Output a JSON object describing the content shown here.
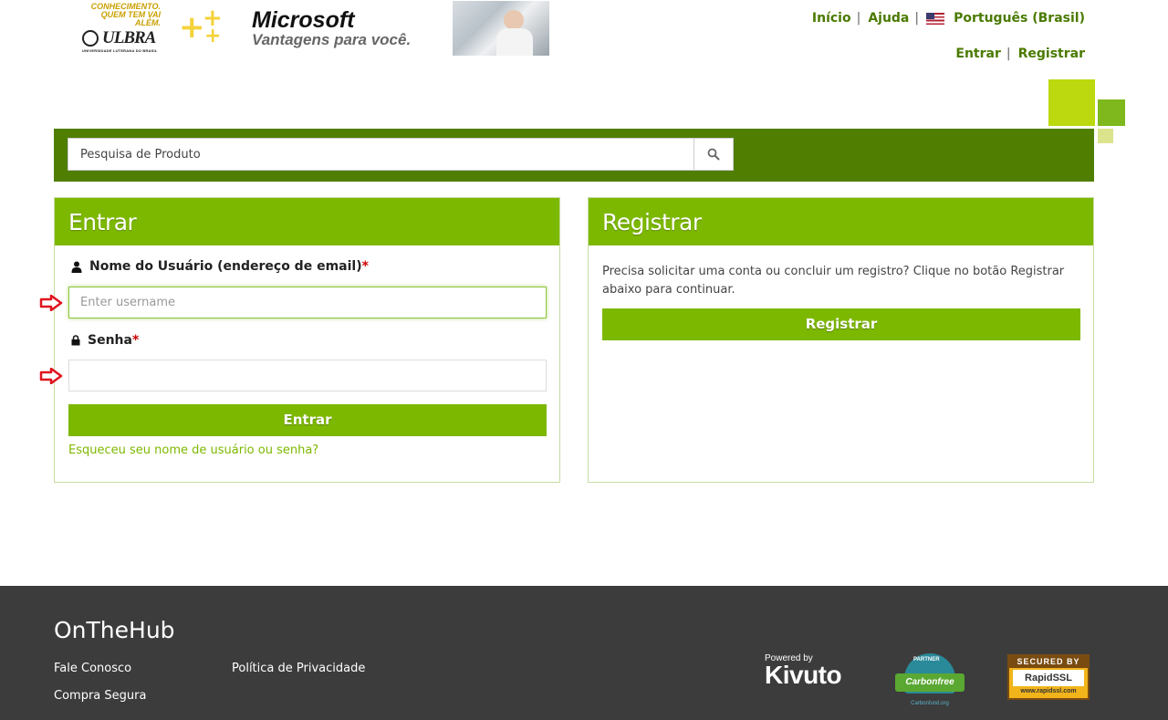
{
  "banner": {
    "ulbra_tagline": "CONHECIMENTO. QUEM TEM VAI ALÉM.",
    "ulbra_name": "ULBRA",
    "ulbra_full": "UNIVERSIDADE LUTERANA DO BRASIL",
    "brand_title": "Microsoft",
    "brand_subtitle": "Vantagens para você."
  },
  "topnav": {
    "home": "Início",
    "help": "Ajuda",
    "language": "Português (Brasil)",
    "sign_in": "Entrar",
    "register": "Registrar"
  },
  "search": {
    "placeholder": "Pesquisa de Produto"
  },
  "login_panel": {
    "title": "Entrar",
    "username_label": "Nome do Usuário (endereço de email)",
    "required_mark": "*",
    "username_placeholder": "Enter username",
    "password_label": "Senha",
    "password_value": "",
    "submit_label": "Entrar",
    "forgot_link": "Esqueceu seu nome de usuário ou senha?"
  },
  "register_panel": {
    "title": "Registrar",
    "description": "Precisa solicitar uma conta ou concluir um registro? Clique no botão Registrar abaixo para continuar.",
    "button_label": "Registrar"
  },
  "footer": {
    "title": "OnTheHub",
    "links": {
      "contact": "Fale Conosco",
      "privacy": "Política de Privacidade",
      "secure": "Compra Segura"
    },
    "badges": {
      "kivuto_powered": "Powered by",
      "kivuto_name": "Kivuto",
      "carbon_partner": "PARTNER",
      "carbon_name": "Carbonfree",
      "carbon_url": "Carbonfund.org",
      "rapid_secured": "SECURED BY",
      "rapid_name": "RapidSSL",
      "rapid_url": "www.rapidssl.com"
    }
  },
  "colors": {
    "accent_green": "#7db800",
    "dark_green": "#4f7e00",
    "nav_green": "#4a7a00",
    "footer_bg": "#3c3c3c",
    "arrow_red": "#e0141e"
  }
}
